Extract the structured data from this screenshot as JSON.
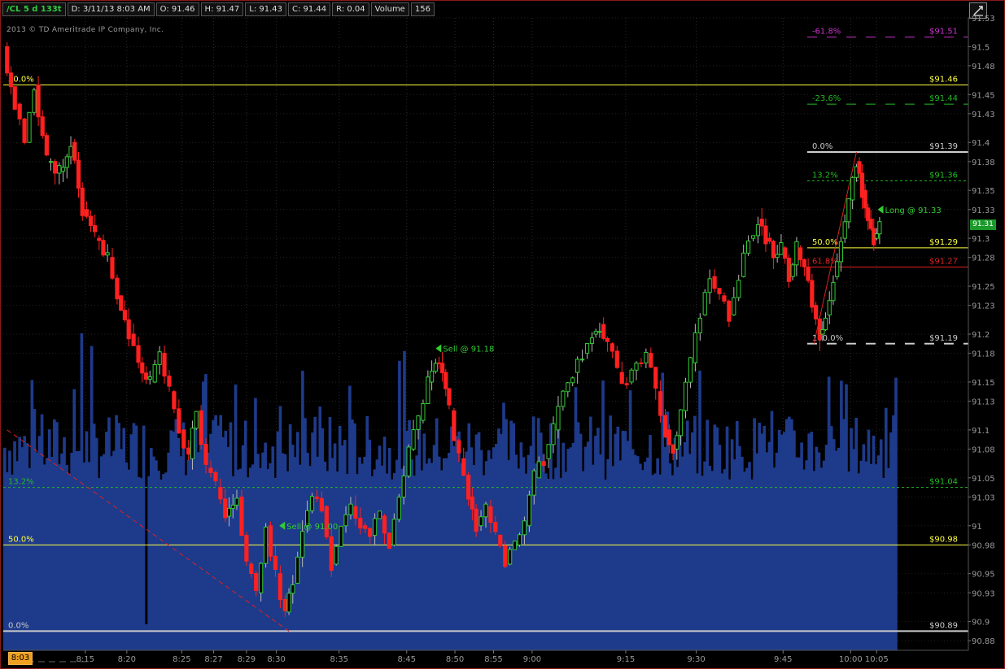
{
  "header": {
    "symbol": "/CL 5 d 133t",
    "date": "D: 3/11/13 8:03 AM",
    "open": "O: 91.46",
    "high": "H: 91.47",
    "low": "L: 91.43",
    "close": "C: 91.44",
    "range": "R: 0.04",
    "volume_label": "Volume",
    "volume_value": "156"
  },
  "copyright": "2013 © TD Ameritrade IP Company, Inc.",
  "current_time": "8:03",
  "current_price": "91.31",
  "colors": {
    "up": "#33cc33",
    "down": "#ff2020",
    "volume": "#1e3a8a",
    "fib_yellow": "#ffff40",
    "fib_green": "#22bb22",
    "fib_magenta": "#cc33cc",
    "fib_red": "#dd2222",
    "fib_white": "#cccccc"
  },
  "chart_data": {
    "type": "candlestick",
    "ylim": [
      90.87,
      91.53
    ],
    "y_ticks": [
      "90.88",
      "90.9",
      "90.93",
      "90.95",
      "90.98",
      "91",
      "91.03",
      "91.05",
      "91.08",
      "91.1",
      "91.13",
      "91.15",
      "91.18",
      "91.2",
      "91.23",
      "91.25",
      "91.28",
      "91.3",
      "91.33",
      "91.35",
      "91.38",
      "91.4",
      "91.43",
      "91.45",
      "91.48",
      "91.5",
      "91.53"
    ],
    "x_ticks": [
      "8:15",
      "8:20",
      "8:25",
      "8:27",
      "8:29",
      "8:30",
      "8:35",
      "8:45",
      "8:50",
      "8:55",
      "9:00",
      "9:15",
      "9:30",
      "9:45",
      "10:00",
      "10:05"
    ],
    "x_tick_positions": [
      0.085,
      0.128,
      0.185,
      0.218,
      0.252,
      0.283,
      0.348,
      0.418,
      0.468,
      0.508,
      0.548,
      0.645,
      0.718,
      0.808,
      0.878,
      0.905
    ],
    "close_path": [
      [
        0.0,
        91.5
      ],
      [
        0.012,
        91.44
      ],
      [
        0.022,
        91.4
      ],
      [
        0.032,
        91.46
      ],
      [
        0.045,
        91.38
      ],
      [
        0.058,
        91.37
      ],
      [
        0.07,
        91.4
      ],
      [
        0.082,
        91.33
      ],
      [
        0.095,
        91.3
      ],
      [
        0.108,
        91.28
      ],
      [
        0.118,
        91.24
      ],
      [
        0.13,
        91.2
      ],
      [
        0.14,
        91.17
      ],
      [
        0.152,
        91.15
      ],
      [
        0.162,
        91.18
      ],
      [
        0.172,
        91.14
      ],
      [
        0.182,
        91.1
      ],
      [
        0.192,
        91.07
      ],
      [
        0.2,
        91.12
      ],
      [
        0.21,
        91.06
      ],
      [
        0.22,
        91.04
      ],
      [
        0.23,
        91.01
      ],
      [
        0.242,
        91.03
      ],
      [
        0.252,
        90.96
      ],
      [
        0.262,
        90.93
      ],
      [
        0.272,
        91.0
      ],
      [
        0.282,
        90.95
      ],
      [
        0.292,
        90.91
      ],
      [
        0.3,
        90.94
      ],
      [
        0.31,
        91.0
      ],
      [
        0.32,
        91.03
      ],
      [
        0.33,
        91.02
      ],
      [
        0.34,
        90.96
      ],
      [
        0.35,
        91.0
      ],
      [
        0.36,
        91.02
      ],
      [
        0.37,
        91.0
      ],
      [
        0.38,
        90.99
      ],
      [
        0.39,
        91.01
      ],
      [
        0.4,
        90.98
      ],
      [
        0.41,
        91.03
      ],
      [
        0.42,
        91.08
      ],
      [
        0.43,
        91.11
      ],
      [
        0.44,
        91.15
      ],
      [
        0.448,
        91.17
      ],
      [
        0.455,
        91.16
      ],
      [
        0.462,
        91.12
      ],
      [
        0.472,
        91.07
      ],
      [
        0.482,
        91.03
      ],
      [
        0.49,
        91.0
      ],
      [
        0.5,
        91.02
      ],
      [
        0.51,
        90.99
      ],
      [
        0.52,
        90.96
      ],
      [
        0.53,
        90.98
      ],
      [
        0.54,
        91.0
      ],
      [
        0.55,
        91.05
      ],
      [
        0.56,
        91.07
      ],
      [
        0.57,
        91.1
      ],
      [
        0.58,
        91.14
      ],
      [
        0.59,
        91.16
      ],
      [
        0.6,
        91.18
      ],
      [
        0.61,
        91.2
      ],
      [
        0.618,
        91.21
      ],
      [
        0.626,
        91.19
      ],
      [
        0.636,
        91.16
      ],
      [
        0.646,
        91.15
      ],
      [
        0.656,
        91.17
      ],
      [
        0.666,
        91.18
      ],
      [
        0.676,
        91.14
      ],
      [
        0.686,
        91.1
      ],
      [
        0.694,
        91.08
      ],
      [
        0.702,
        91.12
      ],
      [
        0.712,
        91.17
      ],
      [
        0.722,
        91.22
      ],
      [
        0.732,
        91.26
      ],
      [
        0.742,
        91.24
      ],
      [
        0.752,
        91.22
      ],
      [
        0.762,
        91.26
      ],
      [
        0.772,
        91.3
      ],
      [
        0.782,
        91.32
      ],
      [
        0.79,
        91.3
      ],
      [
        0.798,
        91.28
      ],
      [
        0.806,
        91.29
      ],
      [
        0.814,
        91.26
      ],
      [
        0.822,
        91.29
      ],
      [
        0.83,
        91.27
      ],
      [
        0.838,
        91.23
      ],
      [
        0.846,
        91.2
      ],
      [
        0.852,
        91.22
      ],
      [
        0.86,
        91.26
      ],
      [
        0.868,
        91.3
      ],
      [
        0.876,
        91.34
      ],
      [
        0.884,
        91.38
      ],
      [
        0.89,
        91.35
      ],
      [
        0.896,
        91.32
      ],
      [
        0.902,
        91.3
      ],
      [
        0.908,
        91.31
      ]
    ],
    "volume_ylim": [
      0,
      100
    ],
    "fib_levels": [
      {
        "pct": "-61.8%",
        "price": "$91.51",
        "value": 91.51,
        "color": "magenta",
        "style": "dashed",
        "side": "right"
      },
      {
        "pct": "50.0%",
        "price": "$91.46",
        "value": 91.46,
        "color": "yellow",
        "style": "solid",
        "side": "full"
      },
      {
        "pct": "-23.6%",
        "price": "$91.44",
        "value": 91.44,
        "color": "green",
        "style": "dashed",
        "side": "right"
      },
      {
        "pct": "0.0%",
        "price": "$91.39",
        "value": 91.39,
        "color": "white",
        "style": "solid",
        "side": "right"
      },
      {
        "pct": "13.2%",
        "price": "$91.36",
        "value": 91.36,
        "color": "green",
        "style": "dotted",
        "side": "right"
      },
      {
        "pct": "50.0%",
        "price": "$91.29",
        "value": 91.29,
        "color": "yellow",
        "style": "solid",
        "side": "right"
      },
      {
        "pct": "61.8%",
        "price": "$91.27",
        "value": 91.27,
        "color": "red",
        "style": "solid",
        "side": "right"
      },
      {
        "pct": "100.0%",
        "price": "$91.19",
        "value": 91.19,
        "color": "white",
        "style": "dashed",
        "side": "right"
      },
      {
        "pct": "13.2%",
        "price": "$91.04",
        "value": 91.04,
        "color": "green",
        "style": "dotted",
        "side": "full"
      },
      {
        "pct": "50.0%",
        "price": "$90.98",
        "value": 90.98,
        "color": "yellow",
        "style": "solid",
        "side": "full"
      },
      {
        "pct": "0.0%",
        "price": "$90.89",
        "value": 90.89,
        "color": "white",
        "style": "solid",
        "side": "full"
      }
    ],
    "trade_markers": [
      {
        "label": "Sell @ 91.18",
        "x": 0.448,
        "value": 91.185
      },
      {
        "label": "Sell @ 91.00",
        "x": 0.286,
        "value": 91.0
      },
      {
        "label": "Long @ 91.33",
        "x": 0.906,
        "value": 91.33
      }
    ],
    "trend_lines": [
      {
        "x1": 0.004,
        "y1": 91.1,
        "x2": 0.296,
        "y2": 90.89,
        "color": "red",
        "style": "dashed"
      },
      {
        "x1": 0.84,
        "y1": 91.19,
        "x2": 0.884,
        "y2": 91.39,
        "color": "red",
        "style": "solid"
      }
    ]
  }
}
